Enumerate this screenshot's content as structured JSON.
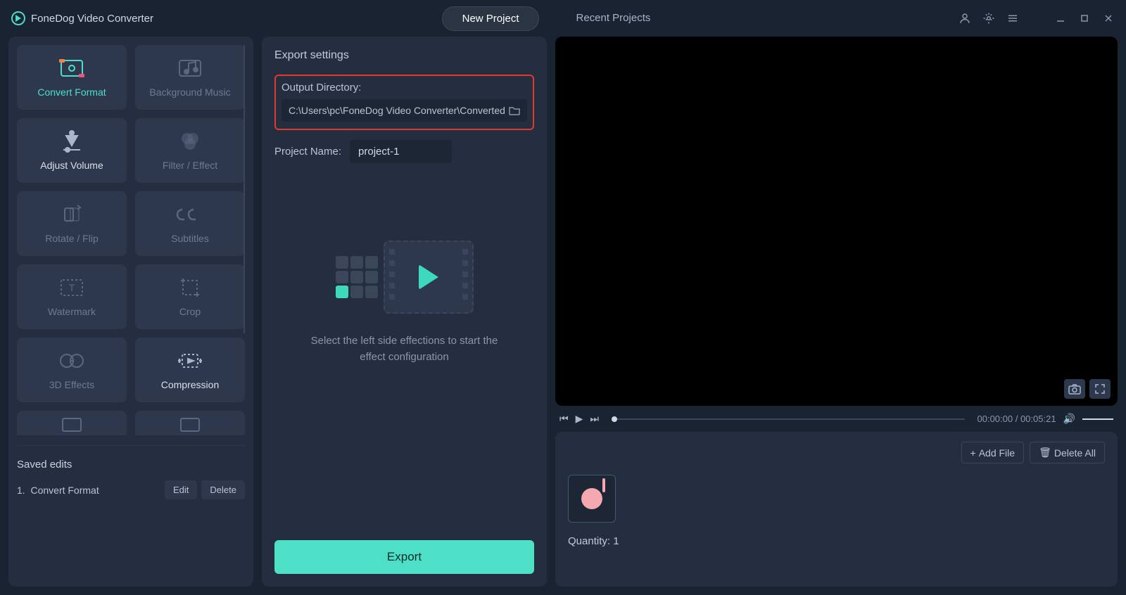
{
  "app_title": "FoneDog Video Converter",
  "tabs": {
    "new_project": "New Project",
    "recent_projects": "Recent Projects"
  },
  "tools": [
    {
      "id": "convert-format",
      "label": "Convert Format",
      "active": true
    },
    {
      "id": "background-music",
      "label": "Background Music"
    },
    {
      "id": "adjust-volume",
      "label": "Adjust Volume",
      "highlight": true
    },
    {
      "id": "filter-effect",
      "label": "Filter / Effect"
    },
    {
      "id": "rotate-flip",
      "label": "Rotate / Flip"
    },
    {
      "id": "subtitles",
      "label": "Subtitles"
    },
    {
      "id": "watermark",
      "label": "Watermark"
    },
    {
      "id": "crop",
      "label": "Crop"
    },
    {
      "id": "3d-effects",
      "label": "3D Effects"
    },
    {
      "id": "compression",
      "label": "Compression",
      "highlight": true
    }
  ],
  "saved_edits": {
    "title": "Saved edits",
    "items": [
      {
        "index": "1.",
        "label": "Convert Format"
      }
    ],
    "edit_btn": "Edit",
    "delete_btn": "Delete"
  },
  "export_settings": {
    "title": "Export settings",
    "output_label": "Output Directory:",
    "output_path": "C:\\Users\\pc\\FoneDog Video Converter\\Converted",
    "project_label": "Project Name:",
    "project_value": "project-1",
    "placeholder_text": "Select the left side effections to start the effect configuration",
    "export_btn": "Export"
  },
  "player": {
    "time_current": "00:00:00",
    "time_total": "00:05:21"
  },
  "gallery": {
    "add_file": "Add File",
    "delete_all": "Delete All",
    "quantity_label": "Quantity:",
    "quantity_value": "1"
  }
}
